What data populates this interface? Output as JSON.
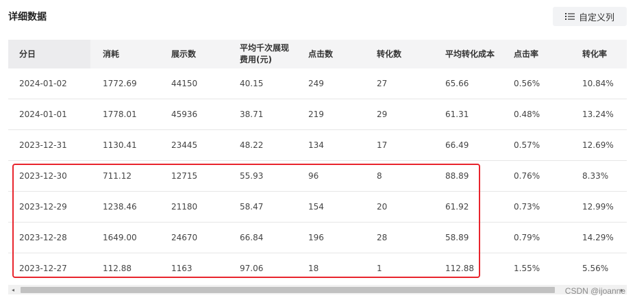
{
  "header": {
    "title": "详细数据",
    "customize_columns_label": "自定义列"
  },
  "table": {
    "columns": [
      "分日",
      "消耗",
      "展示数",
      "平均千次展现费用(元)",
      "点击数",
      "转化数",
      "平均转化成本",
      "点击率",
      "转化率"
    ],
    "rows": [
      [
        "2024-01-02",
        "1772.69",
        "44150",
        "40.15",
        "249",
        "27",
        "65.66",
        "0.56%",
        "10.84%"
      ],
      [
        "2024-01-01",
        "1778.01",
        "45936",
        "38.71",
        "219",
        "29",
        "61.31",
        "0.48%",
        "13.24%"
      ],
      [
        "2023-12-31",
        "1130.41",
        "23445",
        "48.22",
        "134",
        "17",
        "66.49",
        "0.57%",
        "12.69%"
      ],
      [
        "2023-12-30",
        "711.12",
        "12715",
        "55.93",
        "96",
        "8",
        "88.89",
        "0.76%",
        "8.33%"
      ],
      [
        "2023-12-29",
        "1238.46",
        "21180",
        "58.47",
        "154",
        "20",
        "61.92",
        "0.73%",
        "12.99%"
      ],
      [
        "2023-12-28",
        "1649.00",
        "24670",
        "66.84",
        "196",
        "28",
        "58.89",
        "0.79%",
        "14.29%"
      ],
      [
        "2023-12-27",
        "112.88",
        "1163",
        "97.06",
        "18",
        "1",
        "112.88",
        "1.55%",
        "5.56%"
      ]
    ]
  },
  "scrollbar": {
    "left_arrow": "◂",
    "right_arrow": "▸"
  },
  "watermark": "CSDN @ijoanne",
  "colors": {
    "highlight_border": "#e8242c",
    "header_bg": "#f4f4f5"
  }
}
